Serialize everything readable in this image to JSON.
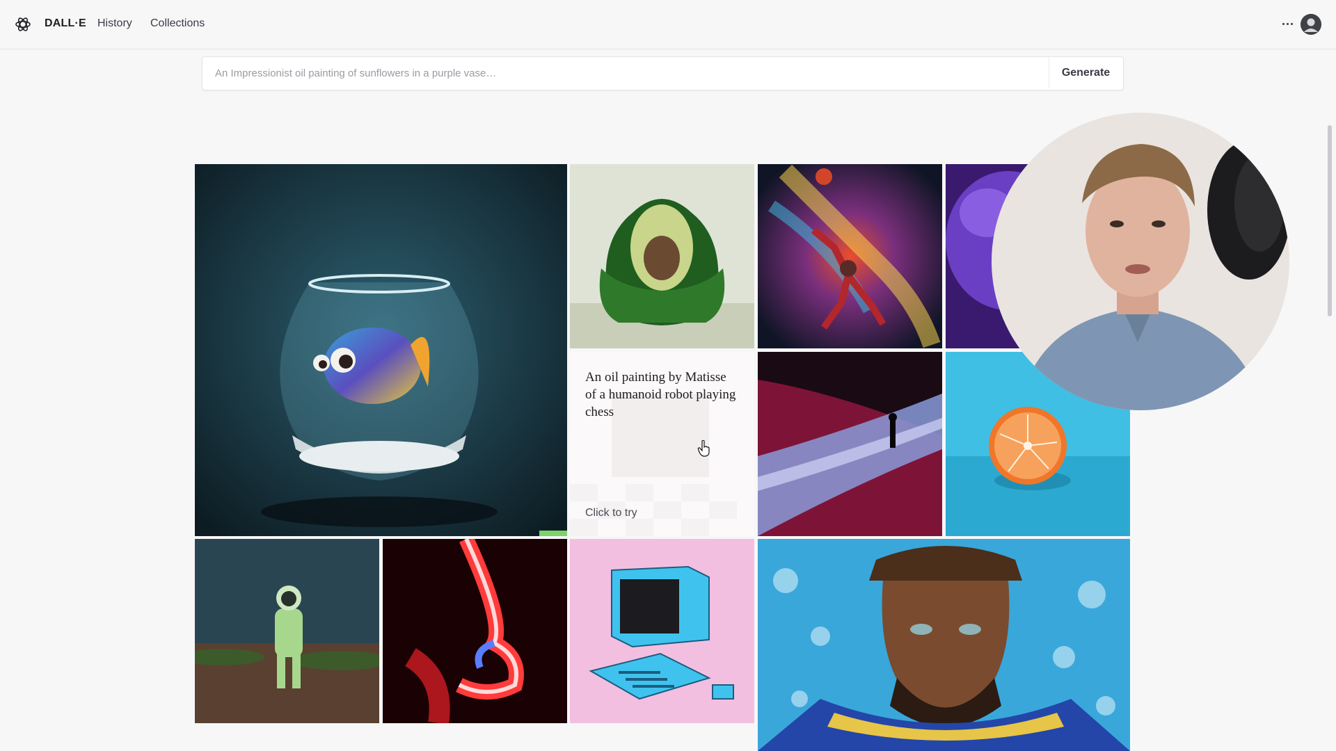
{
  "app": {
    "brand": "DALL·E",
    "nav": [
      {
        "label": "History"
      },
      {
        "label": "Collections"
      }
    ],
    "logo_icon": "openai-logo-icon",
    "more_icon": "more-horizontal-icon",
    "avatar_icon": "user-avatar-icon"
  },
  "prompt": {
    "placeholder": "An Impressionist oil painting of sunflowers in a purple vase…",
    "value": "",
    "generate_label": "Generate"
  },
  "gallery": {
    "caption_card": {
      "text": "An oil painting by Matisse of a humanoid robot playing chess",
      "cta": "Click to try"
    },
    "tiles": [
      {
        "subject": "fish-in-bowl-image"
      },
      {
        "subject": "avocado-armchair-image"
      },
      {
        "subject": "cosmic-basketball-player-image"
      },
      {
        "subject": "purple-creature-image"
      },
      {
        "subject": "figure-in-neon-canyon-image"
      },
      {
        "subject": "orange-half-image"
      },
      {
        "subject": "astronaut-in-desert-image"
      },
      {
        "subject": "neon-face-image"
      },
      {
        "subject": "retro-computer-image"
      },
      {
        "subject": "football-player-portrait-image"
      }
    ]
  },
  "colors": {
    "background": "#f7f7f8",
    "text": "#202123",
    "muted": "#9a9ba3"
  }
}
